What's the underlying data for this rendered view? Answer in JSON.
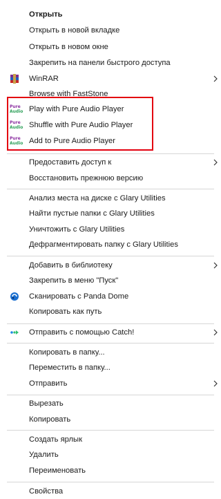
{
  "menu": {
    "items": {
      "open": "Открыть",
      "open_new_tab": "Открыть в новой вкладке",
      "open_new_window": "Открыть в новом окне",
      "pin_quick_access": "Закрепить на панели быстрого доступа",
      "winrar": "WinRAR",
      "browse_faststone": "Browse with FastStone",
      "play_pure": "Play with Pure Audio Player",
      "shuffle_pure": "Shuffle with Pure Audio Player",
      "add_pure": "Add to Pure Audio Player",
      "grant_access": "Предоставить доступ к",
      "restore_previous": "Восстановить прежнюю версию",
      "analyze_glary": "Анализ места на диске с Glary Utilities",
      "find_empty_glary": "Найти пустые папки с Glary Utilities",
      "destroy_glary": "Уничтожить с Glary Utilities",
      "defrag_glary": "Дефрагментировать папку с Glary Utilities",
      "add_library": "Добавить в библиотеку",
      "pin_start": "Закрепить в меню \"Пуск\"",
      "scan_panda": "Сканировать с Panda Dome",
      "copy_path": "Копировать как путь",
      "send_catch": "Отправить с помощью Catch!",
      "copy_to": "Копировать в папку...",
      "move_to": "Переместить в папку...",
      "send_to": "Отправить",
      "cut": "Вырезать",
      "copy": "Копировать",
      "create_shortcut": "Создать ярлык",
      "delete": "Удалить",
      "rename": "Переименовать",
      "properties": "Свойства"
    },
    "icons": {
      "pure_line1": "Pure",
      "pure_line2": "Audio"
    },
    "colors": {
      "highlight_border": "#e3000f",
      "separator": "#d6d6d6",
      "panda_blue": "#1a6fd0",
      "catch_blue": "#1e88e5"
    }
  }
}
